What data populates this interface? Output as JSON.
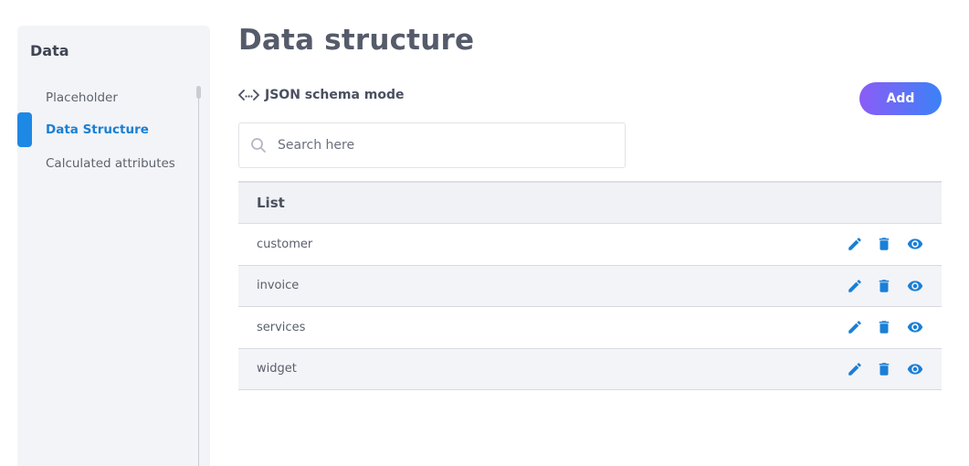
{
  "sidebar": {
    "title": "Data",
    "items": [
      {
        "label": "Placeholder",
        "active": false
      },
      {
        "label": "Data Structure",
        "active": true
      },
      {
        "label": "Calculated attributes",
        "active": false
      }
    ]
  },
  "header": {
    "title": "Data structure",
    "json_mode_label": "JSON schema mode",
    "add_label": "Add"
  },
  "search": {
    "placeholder": "Search here",
    "value": ""
  },
  "table": {
    "header": "List",
    "rows": [
      {
        "name": "customer"
      },
      {
        "name": "invoice"
      },
      {
        "name": "services"
      },
      {
        "name": "widget"
      }
    ],
    "row_actions": [
      "pencil-icon",
      "trash-icon",
      "eye-icon"
    ]
  },
  "colors": {
    "accent": "#1e88e5",
    "add_gradient_start": "#8b5cf6",
    "add_gradient_end": "#3b82f6",
    "icon_blue": "#1a7fd6"
  }
}
